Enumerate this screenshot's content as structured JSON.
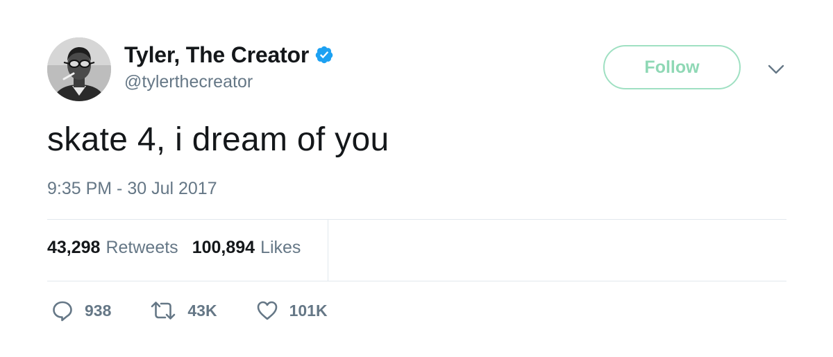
{
  "user": {
    "display_name": "Tyler, The Creator",
    "handle": "@tylerthecreator",
    "verified": true,
    "verified_icon": "verified-badge-icon",
    "verified_color": "#1da1f2"
  },
  "follow_button": {
    "label": "Follow",
    "color": "#8fd8b5"
  },
  "menu": {
    "icon": "chevron-down-icon"
  },
  "tweet": {
    "text": "skate 4, i dream of you",
    "timestamp": "9:35 PM - 30 Jul 2017"
  },
  "stats": {
    "retweets_count": "43,298",
    "retweets_label": "Retweets",
    "likes_count": "100,894",
    "likes_label": "Likes"
  },
  "actions": {
    "reply": {
      "icon": "reply-icon",
      "count": "938"
    },
    "retweet": {
      "icon": "retweet-icon",
      "count": "43K"
    },
    "like": {
      "icon": "heart-icon",
      "count": "101K"
    }
  },
  "colors": {
    "text_primary": "#14171a",
    "text_secondary": "#657786",
    "divider": "#e1e8ed"
  }
}
